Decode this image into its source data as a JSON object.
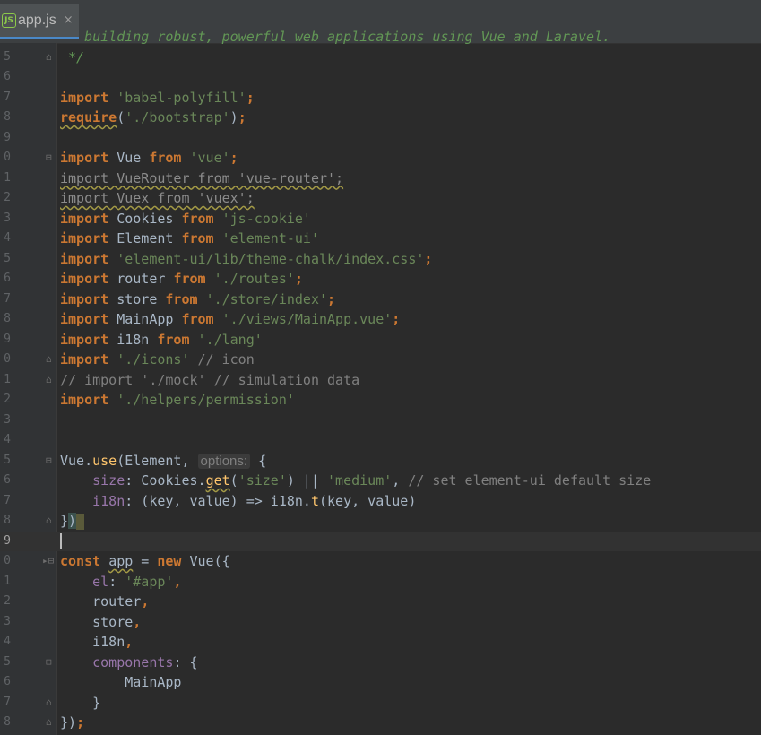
{
  "tab": {
    "filename": "app.js",
    "icon": "nodejs-icon",
    "icon_text": "JS",
    "close": "×"
  },
  "editor": {
    "lines": [
      {
        "n": "",
        "code": "   building robust, powerful web applications using Vue and Laravel."
      },
      {
        "n": "5",
        "code": " */"
      },
      {
        "n": "6",
        "code": ""
      },
      {
        "n": "7",
        "code": "import 'babel-polyfill';"
      },
      {
        "n": "8",
        "code": "require('./bootstrap');"
      },
      {
        "n": "9",
        "code": ""
      },
      {
        "n": "0",
        "code": "import Vue from 'vue';"
      },
      {
        "n": "1",
        "code": "import VueRouter from 'vue-router';"
      },
      {
        "n": "2",
        "code": "import Vuex from 'vuex';"
      },
      {
        "n": "3",
        "code": "import Cookies from 'js-cookie'"
      },
      {
        "n": "4",
        "code": "import Element from 'element-ui'"
      },
      {
        "n": "5",
        "code": "import 'element-ui/lib/theme-chalk/index.css';"
      },
      {
        "n": "6",
        "code": "import router from './routes';"
      },
      {
        "n": "7",
        "code": "import store from './store/index';"
      },
      {
        "n": "8",
        "code": "import MainApp from './views/MainApp.vue';"
      },
      {
        "n": "9",
        "code": "import i18n from './lang'"
      },
      {
        "n": "0",
        "code": "import './icons' // icon"
      },
      {
        "n": "1",
        "code": "// import './mock' // simulation data"
      },
      {
        "n": "2",
        "code": "import './helpers/permission'"
      },
      {
        "n": "3",
        "code": ""
      },
      {
        "n": "4",
        "code": ""
      },
      {
        "n": "5",
        "code": "Vue.use(Element, options: {"
      },
      {
        "n": "6",
        "code": "    size: Cookies.get('size') || 'medium', // set element-ui default size"
      },
      {
        "n": "7",
        "code": "    i18n: (key, value) => i18n.t(key, value)"
      },
      {
        "n": "8",
        "code": "})"
      },
      {
        "n": "9",
        "code": ""
      },
      {
        "n": "0",
        "code": "const app = new Vue({"
      },
      {
        "n": "1",
        "code": "    el: '#app',"
      },
      {
        "n": "2",
        "code": "    router,"
      },
      {
        "n": "3",
        "code": "    store,"
      },
      {
        "n": "4",
        "code": "    i18n,"
      },
      {
        "n": "5",
        "code": "    components: {"
      },
      {
        "n": "6",
        "code": "        MainApp"
      },
      {
        "n": "7",
        "code": "    }"
      },
      {
        "n": "8",
        "code": "});"
      }
    ],
    "param_hint": "options:"
  },
  "colors": {
    "background": "#2b2b2b",
    "keyword": "#cc7832",
    "string": "#6a8759",
    "comment": "#808080",
    "property": "#9876aa",
    "function": "#ffc66d",
    "text": "#a9b7c6"
  }
}
